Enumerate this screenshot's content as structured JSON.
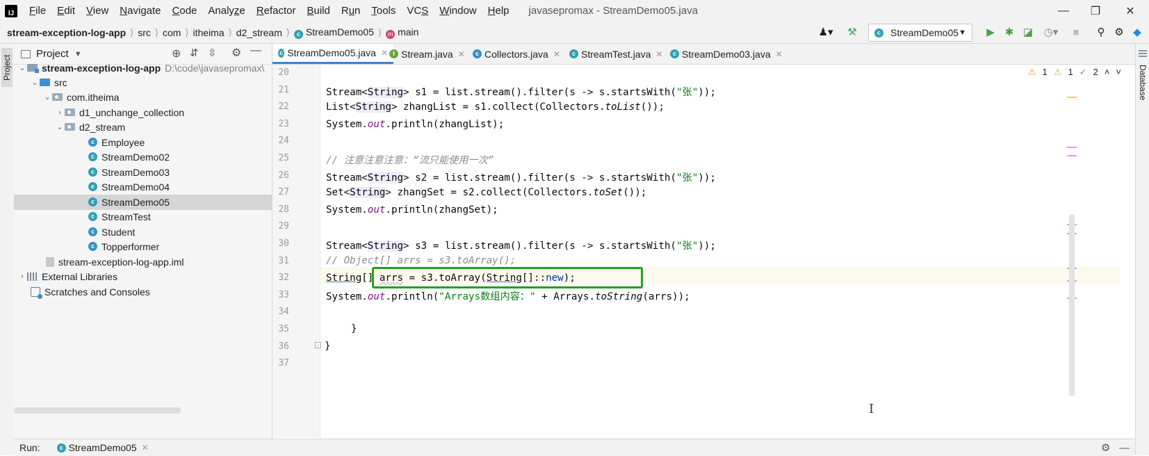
{
  "menubar": {
    "items": [
      {
        "pre": "",
        "u": "F",
        "post": "ile"
      },
      {
        "pre": "",
        "u": "E",
        "post": "dit"
      },
      {
        "pre": "",
        "u": "V",
        "post": "iew"
      },
      {
        "pre": "",
        "u": "N",
        "post": "avigate"
      },
      {
        "pre": "",
        "u": "C",
        "post": "ode"
      },
      {
        "pre": "Analy",
        "u": "z",
        "post": "e"
      },
      {
        "pre": "",
        "u": "R",
        "post": "efactor"
      },
      {
        "pre": "",
        "u": "B",
        "post": "uild"
      },
      {
        "pre": "R",
        "u": "u",
        "post": "n"
      },
      {
        "pre": "",
        "u": "T",
        "post": "ools"
      },
      {
        "pre": "VC",
        "u": "S",
        "post": ""
      },
      {
        "pre": "",
        "u": "W",
        "post": "indow"
      },
      {
        "pre": "",
        "u": "H",
        "post": "elp"
      }
    ],
    "window_title": "javasepromax - StreamDemo05.java"
  },
  "breadcrumb": {
    "project": "stream-exception-log-app",
    "parts": [
      "src",
      "com",
      "itheima",
      "d2_stream"
    ],
    "class": "StreamDemo05",
    "method": "main"
  },
  "toolbar": {
    "run_config": "StreamDemo05"
  },
  "project_panel": {
    "title": "Project",
    "stripe_label": "Project",
    "tree": {
      "root": "stream-exception-log-app",
      "root_path": "D:\\code\\javasepromax\\",
      "src": "src",
      "pkg": "com.itheima",
      "d1": "d1_unchange_collection",
      "d2": "d2_stream",
      "classes": [
        "Employee",
        "StreamDemo02",
        "StreamDemo03",
        "StreamDemo04",
        "StreamDemo05",
        "StreamTest",
        "Student",
        "Topperformer"
      ],
      "iml": "stream-exception-log-app.iml",
      "ext": "External Libraries",
      "scratch": "Scratches and Consoles"
    }
  },
  "tabs": [
    "StreamDemo05.java",
    "Stream.java",
    "Collectors.java",
    "StreamTest.java",
    "StreamDemo03.java"
  ],
  "inspections": {
    "warn1": "1",
    "warn2": "1",
    "ok": "2"
  },
  "right_stripe_label": "Database",
  "editor": {
    "line_numbers": [
      "20",
      "21",
      "22",
      "23",
      "24",
      "25",
      "26",
      "27",
      "28",
      "29",
      "30",
      "31",
      "32",
      "33",
      "34",
      "35",
      "36",
      "37"
    ],
    "l21": {
      "a": "Stream<",
      "b": "String",
      "c": "> s1 = list.stream().filter(s -> s.startsWith(",
      "d": "\"张\"",
      "e": "));"
    },
    "l22": {
      "a": "List<",
      "b": "String",
      "c": "> zhangList = s1.collect(Collectors.",
      "d": "toList",
      "e": "());"
    },
    "l23": {
      "a": "System.",
      "b": "out",
      "c": ".println(zhangList);"
    },
    "l25": "// 注意注意注意：“流只能使用一次”",
    "l26": {
      "a": "Stream<",
      "b": "String",
      "c": "> s2 = list.stream().filter(s -> s.startsWith(",
      "d": "\"张\"",
      "e": "));"
    },
    "l27": {
      "a": "Set<",
      "b": "String",
      "c": "> zhangSet = s2.collect(Collectors.",
      "d": "toSet",
      "e": "());"
    },
    "l28": {
      "a": "System.",
      "b": "out",
      "c": ".println(zhangSet);"
    },
    "l30": {
      "a": "Stream<",
      "b": "String",
      "c": "> s3 = list.stream().filter(s -> s.startsWith(",
      "d": "\"张\"",
      "e": "));"
    },
    "l31": "// Object[] arrs = s3.toArray();",
    "l32": {
      "a": "String",
      "b": "[] ",
      "c": "arrs",
      "d": " = s3.toArray(",
      "e": "String",
      "f": "[]::",
      "g": "new",
      "h": ");"
    },
    "l33": {
      "a": "System.",
      "b": "out",
      "c": ".println(",
      "d": "\"Arrays数组内容：\"",
      "e": " + Arrays.",
      "f": "toString",
      "g": "(arrs));"
    },
    "l35": "}",
    "l36": "}"
  },
  "bottom": {
    "run_label": "Run:",
    "run_tab": "StreamDemo05"
  }
}
